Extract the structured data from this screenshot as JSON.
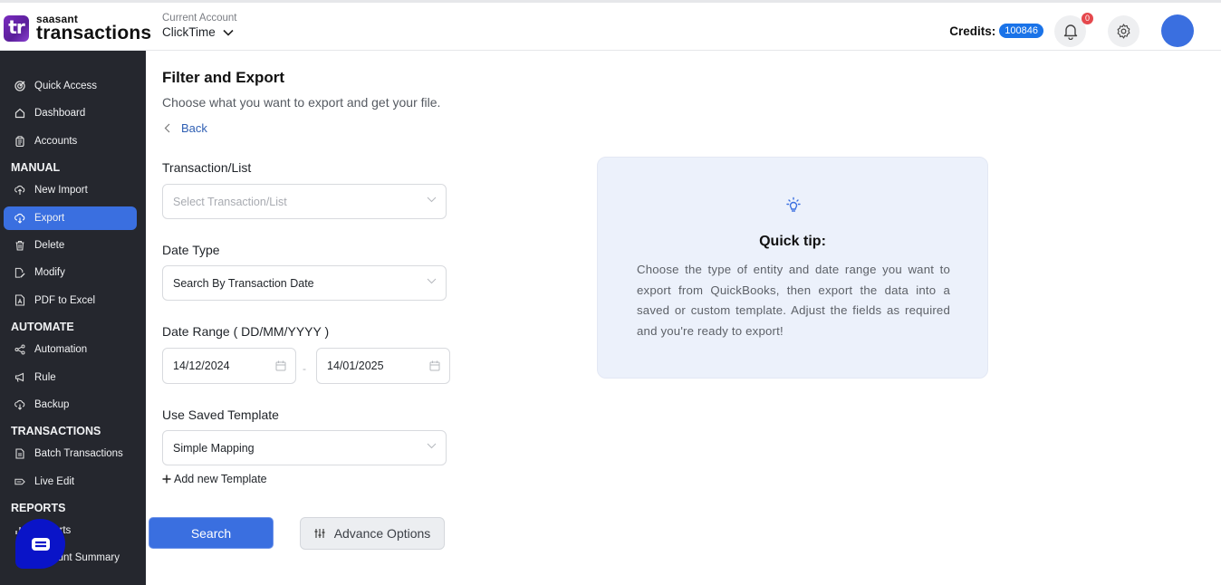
{
  "header": {
    "logo_mark": "tr",
    "logo_small": "saasant",
    "logo_big": "transactions",
    "account_label": "Current Account",
    "account_name": "ClickTime",
    "credits_label": "Credits:",
    "credits_value": "100846",
    "notifications_count": "0"
  },
  "sidebar": {
    "items_top": [
      {
        "label": "Quick Access",
        "icon": "target-icon"
      },
      {
        "label": "Dashboard",
        "icon": "home-icon"
      },
      {
        "label": "Accounts",
        "icon": "clipboard-icon"
      }
    ],
    "sections": [
      {
        "title": "MANUAL",
        "items": [
          {
            "label": "New Import",
            "icon": "cloud-upload-icon"
          },
          {
            "label": "Export",
            "icon": "cloud-download-icon",
            "active": true
          },
          {
            "label": "Delete",
            "icon": "trash-icon"
          },
          {
            "label": "Modify",
            "icon": "file-edit-icon"
          },
          {
            "label": "PDF to Excel",
            "icon": "pdf-file-icon"
          }
        ]
      },
      {
        "title": "AUTOMATE",
        "items": [
          {
            "label": "Automation",
            "icon": "share-nodes-icon"
          },
          {
            "label": "Rule",
            "icon": "megaphone-icon"
          },
          {
            "label": "Backup",
            "icon": "cloud-download-icon"
          }
        ]
      },
      {
        "title": "TRANSACTIONS",
        "items": [
          {
            "label": "Batch Transactions",
            "icon": "document-icon"
          },
          {
            "label": "Live Edit",
            "icon": "pencil-icon"
          }
        ]
      },
      {
        "title": "REPORTS",
        "items": [
          {
            "label": "Reports",
            "icon": "chart-icon"
          },
          {
            "label": "Account Summary",
            "icon": "clipboard-icon"
          }
        ]
      }
    ]
  },
  "main": {
    "title": "Filter and Export",
    "subtitle": "Choose what you want to export and get your file.",
    "back_label": "Back",
    "transaction_label": "Transaction/List",
    "transaction_placeholder": "Select Transaction/List",
    "date_type_label": "Date Type",
    "date_type_value": "Search By Transaction Date",
    "date_range_label": "Date Range ( DD/MM/YYYY )",
    "date_from": "14/12/2024",
    "date_to": "14/01/2025",
    "date_separator": "-",
    "template_label": "Use Saved Template",
    "template_value": "Simple Mapping",
    "add_template_label": "Add new Template",
    "search_button": "Search",
    "advance_button": "Advance Options"
  },
  "tip": {
    "title": "Quick tip:",
    "body": "Choose the type of entity and date range you want to export from QuickBooks, then export the data into a saved or custom template. Adjust the fields as required and you're ready to export!"
  },
  "colors": {
    "accent": "#3a6fe0",
    "sidebar_bg": "#25272e",
    "tip_bg": "#ecf1fb",
    "credits_badge": "#1a73e8",
    "chat_bubble": "#0a14c8"
  }
}
